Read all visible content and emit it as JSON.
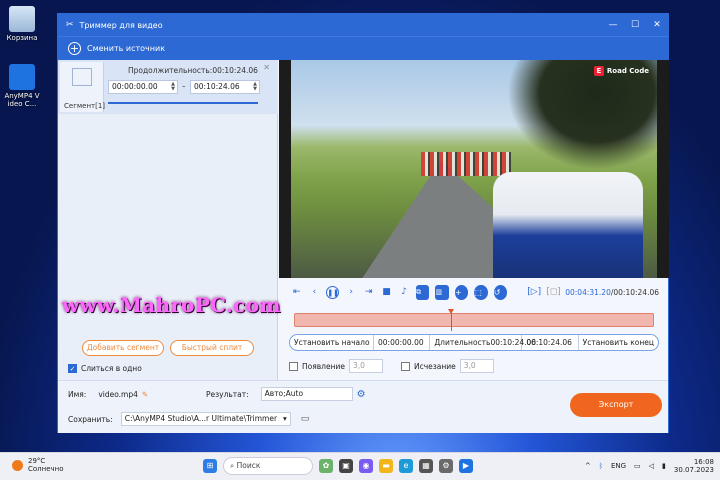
{
  "desktop": {
    "icons": [
      {
        "label": "Корзина",
        "icon": "recycle-bin-icon"
      },
      {
        "label": "AnyMP4 Video C...",
        "icon": "anymp4-app-icon"
      }
    ]
  },
  "window": {
    "title": "Триммер для видео",
    "controls": {
      "minimize": "—",
      "maximize": "☐",
      "close": "✕"
    },
    "change_source": "Сменить источник"
  },
  "segment": {
    "label": "Сегмент[1]",
    "duration_label": "Продолжительность:00:10:24.06",
    "start": "00:00:00.00",
    "separator": "–",
    "end": "00:10:24.06"
  },
  "video": {
    "watermark": "Road Code",
    "watermark_logo": "E"
  },
  "playback": {
    "current_time": "00:04:31.20",
    "total_time": "/00:10:24.06",
    "playhead_fraction": 0.435
  },
  "trim": {
    "set_start": "Установить начало",
    "start_time": "00:00:00.00",
    "duration_label": "Длительность00:10:24.06",
    "end_time": "00:10:24.06",
    "set_end": "Установить конец"
  },
  "effects": {
    "fade_in_label": "Появление",
    "fade_in_value": "3,0",
    "fade_out_label": "Исчезание",
    "fade_out_value": "3,0"
  },
  "left_actions": {
    "add_segment": "Добавить сегмент",
    "quick_split": "Быстрый сплит",
    "merge_label": "Слиться в одно",
    "merge_checked": "✓"
  },
  "bottom": {
    "name_label": "Имя:",
    "name_value": "video.mp4",
    "result_label": "Результат:",
    "result_value": "Авто;Auto",
    "save_label": "Сохранить:",
    "save_path": "C:\\AnyMP4 Studio\\A...r Ultimate\\Trimmer",
    "export_label": "Экспорт"
  },
  "watermark_site": "www.MahroPC.com",
  "taskbar": {
    "weather_temp": "29°C",
    "weather_desc": "Солнечно",
    "search_placeholder": "Поиск",
    "lang": "ENG",
    "time": "16:08",
    "date": "30.07.2023"
  },
  "colors": {
    "accent": "#2c69d4",
    "export": "#f0661f",
    "timeline": "#f1b6ad"
  }
}
